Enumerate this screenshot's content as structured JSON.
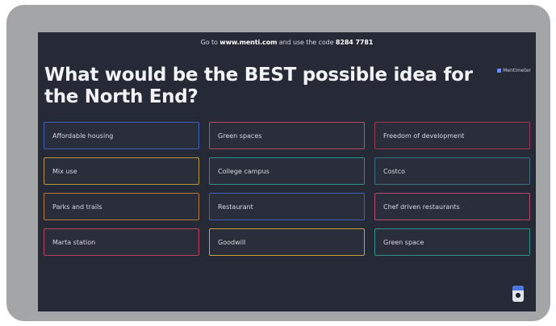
{
  "join": {
    "prefix": "Go to ",
    "url": "www.menti.com",
    "middle": " and use the code ",
    "code": "8284 7781"
  },
  "question": "What would be the BEST possible idea for the North End?",
  "brand": "Mentimeter",
  "colors": {
    "background": "#262936",
    "frame": "#a4a5a7",
    "text": "#f2f3f6"
  },
  "responses": [
    {
      "text": "Affordable housing",
      "color": "#3d5fb8"
    },
    {
      "text": "Green spaces",
      "color": "#b84f68"
    },
    {
      "text": "Freedom of development",
      "color": "#9a3a52"
    },
    {
      "text": "Mix use",
      "color": "#b5963c"
    },
    {
      "text": "College campus",
      "color": "#2e8e86"
    },
    {
      "text": "Costco",
      "color": "#3f6f86"
    },
    {
      "text": "Parks and trails",
      "color": "#b47a3a"
    },
    {
      "text": "Restaurant",
      "color": "#3f5fb5"
    },
    {
      "text": "Chef driven restaurants",
      "color": "#b34b6a"
    },
    {
      "text": "Marta station",
      "color": "#b0475e"
    },
    {
      "text": "Goodwill",
      "color": "#c5a03f"
    },
    {
      "text": "Green space",
      "color": "#2f8f8a"
    }
  ],
  "fab_icon": "person-icon"
}
